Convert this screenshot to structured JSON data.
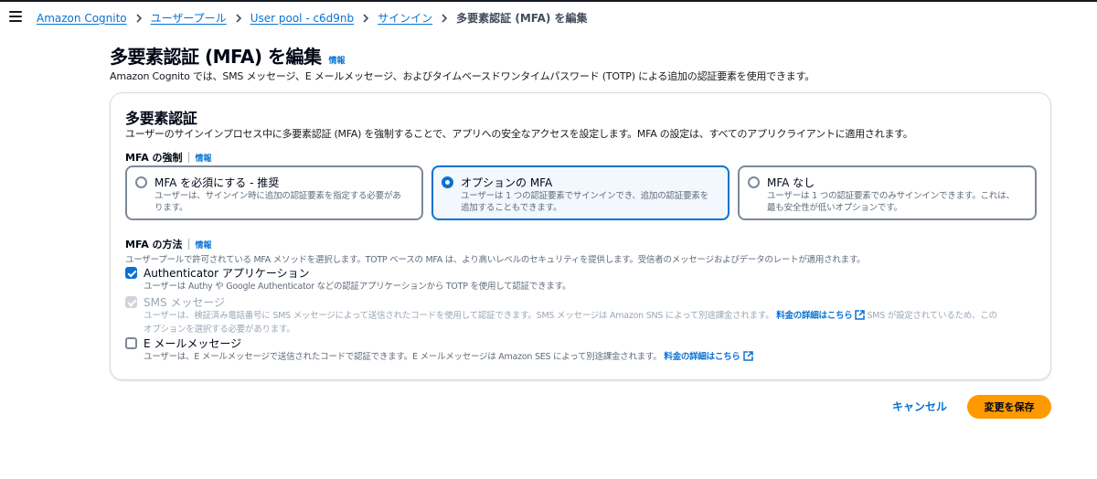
{
  "breadcrumb": {
    "items": [
      "Amazon Cognito",
      "ユーザープール",
      "User pool - c6d9nb",
      "サインイン"
    ],
    "current": "多要素認証 (MFA) を編集"
  },
  "header": {
    "title": "多要素認証 (MFA) を編集",
    "info": "情報",
    "description": "Amazon Cognito では、SMS メッセージ、E メールメッセージ、およびタイムベースドワンタイムパスワード (TOTP) による追加の認証要素を使用できます。"
  },
  "mfa_section": {
    "title": "多要素認証",
    "description": "ユーザーのサインインプロセス中に多要素認証 (MFA) を強制することで、アプリへの安全なアクセスを設定します。MFA の設定は、すべてのアプリクライアントに適用されます。"
  },
  "enforcement": {
    "label": "MFA の強制",
    "info": "情報",
    "selected": "optional",
    "options": [
      {
        "id": "required",
        "title": "MFA を必須にする - 推奨",
        "desc_line1": "ユーザーは、サインイン時に追加の認証要素を指定する必要があ",
        "desc_line2": "ります。"
      },
      {
        "id": "optional",
        "title": "オプションの MFA",
        "desc_line1": "ユーザーは 1 つの認証要素でサインインでき、追加の認証要素を",
        "desc_line2": "追加することもできます。"
      },
      {
        "id": "none",
        "title": "MFA なし",
        "desc_line1": "ユーザーは 1 つの認証要素でのみサインインできます。これは、",
        "desc_line2": "最も安全性が低いオプションです。"
      }
    ]
  },
  "methods": {
    "label": "MFA の方法",
    "info": "情報",
    "description": "ユーザープールで許可されている MFA メソッドを選択します。TOTP ベースの MFA は、より高いレベルのセキュリティを提供します。受信者のメッセージおよびデータのレートが適用されます。",
    "authenticator": {
      "label": "Authenticator アプリケーション",
      "checked": true,
      "desc": "ユーザーは Authy や Google Authenticator などの認証アプリケーションから TOTP を使用して認証できます。"
    },
    "sms": {
      "label": "SMS メッセージ",
      "checked": true,
      "disabled": true,
      "desc_part1": "ユーザーは、検証済み電話番号に SMS メッセージによって送信されたコードを使用して認証できます。SMS メッセージは Amazon SNS によって別途課金されます。",
      "link": "料金の詳細はこちら",
      "desc_part2": "SMS が設定されているため、この",
      "desc_line2": "オプションを選択する必要があります。"
    },
    "email": {
      "label": "E メールメッセージ",
      "checked": false,
      "desc": "ユーザーは、E メールメッセージで送信されたコードで認証できます。E メールメッセージは Amazon SES によって別途課金されます。",
      "link": "料金の詳細はこちら"
    }
  },
  "actions": {
    "cancel": "キャンセル",
    "save": "変更を保存"
  },
  "colors": {
    "link": "#0972d3",
    "primary_button": "#ff9900",
    "selected_tile_bg": "#f2f8fd"
  }
}
